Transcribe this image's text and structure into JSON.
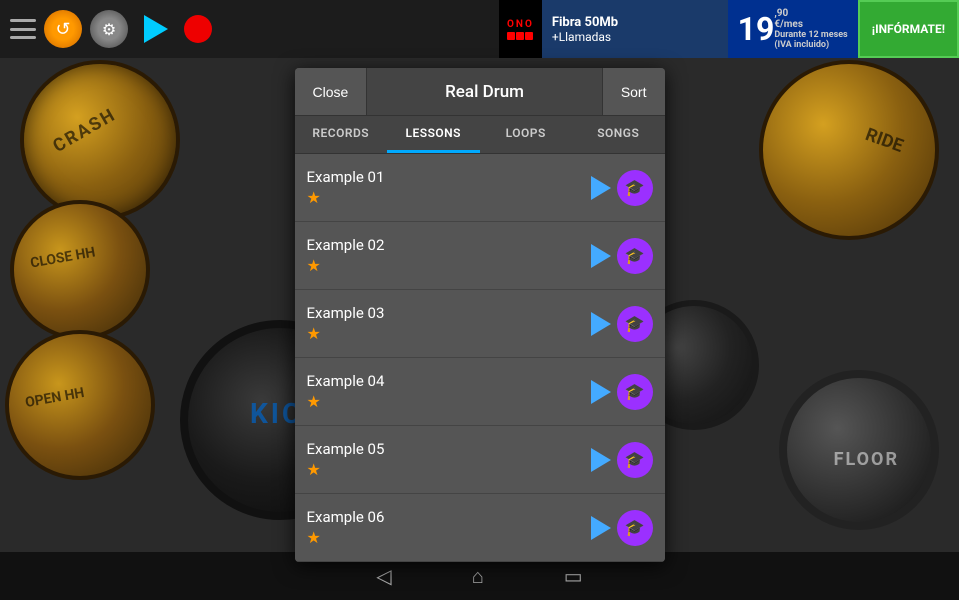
{
  "topbar": {
    "refresh_icon": "↺",
    "settings_icon": "⚙"
  },
  "ad": {
    "brand": "ONO",
    "line1": "Fibra 50Mb",
    "line2": "+Llamadas",
    "price": "19",
    "price_cents": ",90",
    "price_unit": "€/mes",
    "price_note1": "Durante 12 meses",
    "price_note2": "(IVA incluido)",
    "cta": "¡INFÓRMATE!"
  },
  "modal": {
    "close_label": "Close",
    "title": "Real Drum",
    "sort_label": "Sort",
    "tabs": [
      {
        "id": "records",
        "label": "RECORDS",
        "active": false
      },
      {
        "id": "lessons",
        "label": "LESSONS",
        "active": true
      },
      {
        "id": "loops",
        "label": "LOOPS",
        "active": false
      },
      {
        "id": "songs",
        "label": "SONGS",
        "active": false
      }
    ],
    "items": [
      {
        "title": "Example 01",
        "star": "★"
      },
      {
        "title": "Example 02",
        "star": "★"
      },
      {
        "title": "Example 03",
        "star": "★"
      },
      {
        "title": "Example 04",
        "star": "★"
      },
      {
        "title": "Example 05",
        "star": "★"
      },
      {
        "title": "Example 06",
        "star": "★"
      }
    ]
  },
  "bottomnav": {
    "back": "◁",
    "home": "⌂",
    "recent": "▭"
  },
  "drum_labels": {
    "crash": "CRASH",
    "hihat_closed": "CLOSE HH",
    "hihat_open": "OPEN HH",
    "ride": "RIDE",
    "floor": "FLOOR",
    "kick": "Kick"
  }
}
